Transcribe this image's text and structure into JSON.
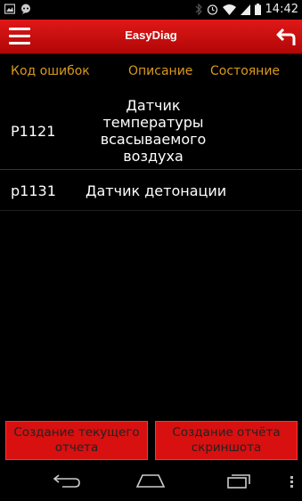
{
  "status_bar": {
    "time": "14:42",
    "icons": [
      "image-notification-icon",
      "chat-notification-icon",
      "bluetooth-icon",
      "alarm-icon",
      "wifi-icon",
      "signal-icon",
      "battery-icon"
    ]
  },
  "action_bar": {
    "title": "EasyDiag",
    "menu_icon": "hamburger-menu-icon",
    "back_icon": "return-arrow-icon"
  },
  "table": {
    "headers": [
      "Код ошибок",
      "Описание",
      "Состояние"
    ],
    "rows": [
      {
        "code": "P1121",
        "description": "Датчик температуры всасываемого воздуха",
        "state": ""
      },
      {
        "code": "p1131",
        "description": "Датчик детонации",
        "state": ""
      }
    ]
  },
  "buttons": {
    "create_report": "Создание текущего отчета",
    "create_screenshot_report": "Создание отчёта скриншота"
  },
  "colors": {
    "accent_red": "#d81010",
    "header_orange": "#d99a1c",
    "background": "#000000"
  },
  "nav_bar": {
    "icons": [
      "back-nav-icon",
      "home-nav-icon",
      "recent-apps-icon",
      "overflow-menu-icon"
    ]
  }
}
